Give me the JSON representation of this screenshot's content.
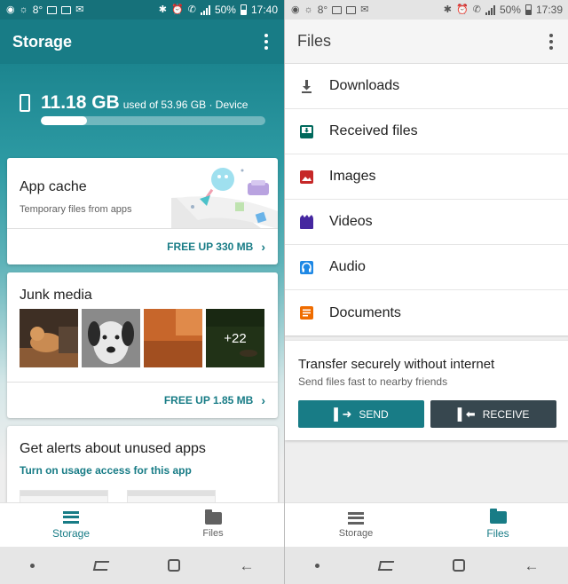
{
  "colors": {
    "accent": "#187c86",
    "receive_button": "#37474f",
    "images": "#c62828",
    "videos": "#4527a0",
    "audio": "#1e88e5",
    "documents": "#ef6c00",
    "received": "#00695c"
  },
  "left": {
    "status": {
      "temp": "8°",
      "battery": "50%",
      "time": "17:40"
    },
    "title": "Storage",
    "storage": {
      "used": "11.18 GB",
      "of": "used of 53.96 GB · Device",
      "fraction": 0.207
    },
    "cache_card": {
      "title": "App cache",
      "subtitle": "Temporary files from apps",
      "action": "FREE UP 330 MB"
    },
    "junk_card": {
      "title": "Junk media",
      "more_count": "+22",
      "action": "FREE UP 1.85 MB"
    },
    "alerts_card": {
      "title": "Get alerts about unused apps",
      "link": "Turn on usage access for this app"
    },
    "nav": {
      "storage": "Storage",
      "files": "Files"
    }
  },
  "right": {
    "status": {
      "temp": "8°",
      "battery": "50%",
      "time": "17:39"
    },
    "title": "Files",
    "items": [
      {
        "label": "Downloads",
        "icon": "download-icon"
      },
      {
        "label": "Received files",
        "icon": "inbox-icon"
      },
      {
        "label": "Images",
        "icon": "image-icon"
      },
      {
        "label": "Videos",
        "icon": "video-icon"
      },
      {
        "label": "Audio",
        "icon": "headphones-icon"
      },
      {
        "label": "Documents",
        "icon": "document-icon"
      }
    ],
    "transfer": {
      "title": "Transfer securely without internet",
      "subtitle": "Send files fast to nearby friends",
      "send": "SEND",
      "receive": "RECEIVE"
    },
    "nav": {
      "storage": "Storage",
      "files": "Files"
    }
  }
}
